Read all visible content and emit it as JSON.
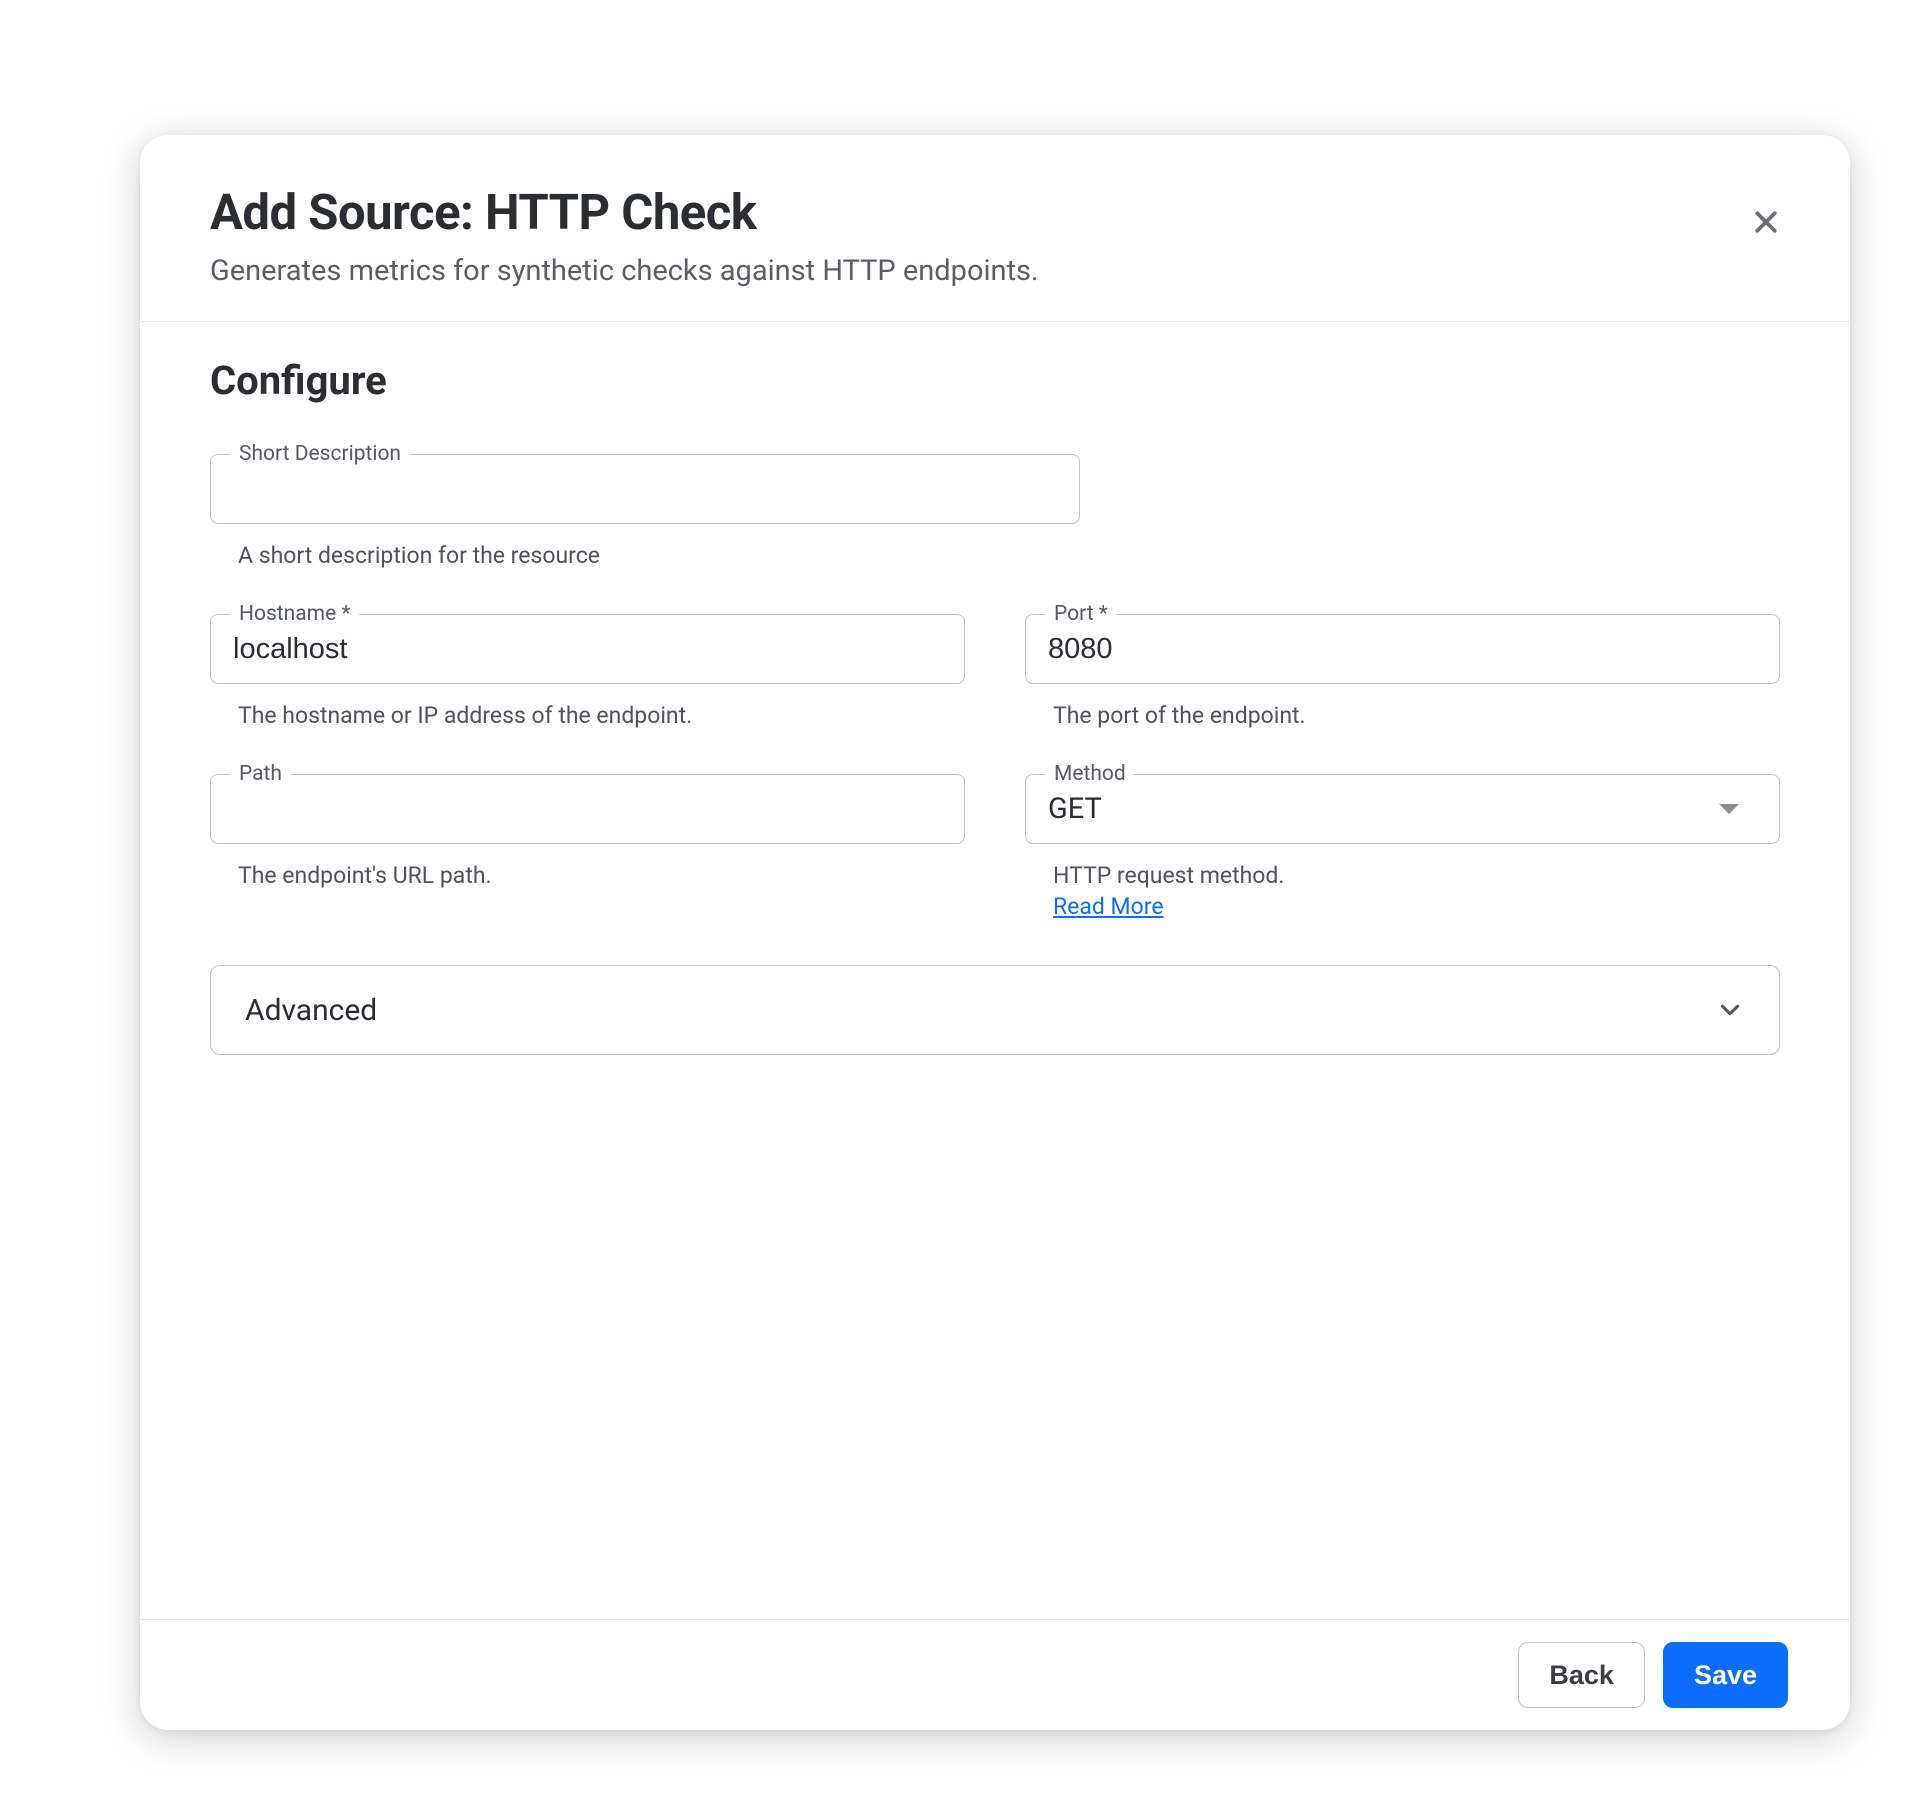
{
  "dialog": {
    "title": "Add Source: HTTP Check",
    "subtitle": "Generates metrics for synthetic checks against HTTP endpoints."
  },
  "section": {
    "configure": "Configure"
  },
  "fields": {
    "short_description": {
      "label": "Short Description",
      "value": "",
      "help": "A short description for the resource"
    },
    "hostname": {
      "label": "Hostname *",
      "value": "localhost",
      "help": "The hostname or IP address of the endpoint."
    },
    "port": {
      "label": "Port *",
      "value": "8080",
      "help": "The port of the endpoint."
    },
    "path": {
      "label": "Path",
      "value": "",
      "help": "The endpoint's URL path."
    },
    "method": {
      "label": "Method",
      "value": "GET",
      "help": "HTTP request method.",
      "read_more": "Read More"
    }
  },
  "accordion": {
    "advanced": "Advanced"
  },
  "footer": {
    "back": "Back",
    "save": "Save"
  }
}
